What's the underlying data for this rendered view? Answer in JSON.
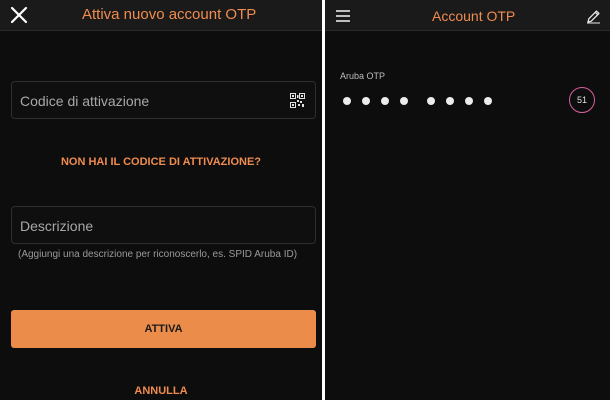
{
  "activate_screen": {
    "title": "Attiva nuovo account OTP",
    "close_icon": "close-icon",
    "activation_code_field": {
      "placeholder": "Codice di attivazione",
      "value": ""
    },
    "qr_icon": "qr-code-icon",
    "no_code_link": "NON HAI IL CODICE DI ATTIVAZIONE?",
    "description_field": {
      "placeholder": "Descrizione",
      "value": ""
    },
    "description_hint": "(Aggiungi una descrizione per riconoscerlo, es. SPID Aruba ID)",
    "activate_button": "ATTIVA",
    "cancel_button": "ANNULLA"
  },
  "accounts_screen": {
    "title": "Account OTP",
    "menu_icon": "menu-icon",
    "edit_icon": "edit-icon",
    "accounts": [
      {
        "name": "Aruba OTP",
        "code_hidden_digits": 8,
        "timer": "51"
      }
    ]
  },
  "colors": {
    "accent": "#ef8c4f",
    "button_bg": "#ec8c4b",
    "background": "#0d0d0d",
    "topbar": "#1a1a1a",
    "timer_ring": "#d55f9f"
  }
}
